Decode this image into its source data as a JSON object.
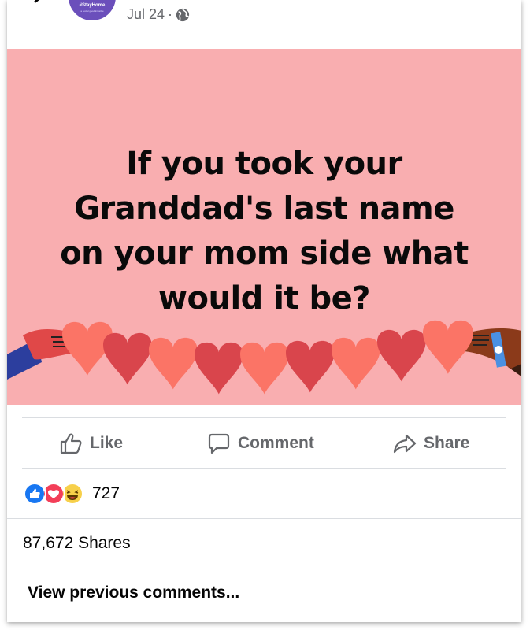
{
  "post": {
    "avatar_text": "#StayHome",
    "avatar_subtext": "a social good initiative",
    "date": "Jul 24",
    "separator": "·",
    "privacy_icon": "globe-icon"
  },
  "image": {
    "background": "#f9aeb0",
    "text_lines": [
      "If you took your",
      "Granddad's last name",
      "on your mom side what",
      "would it be?"
    ]
  },
  "actions": {
    "like_label": "Like",
    "comment_label": "Comment",
    "share_label": "Share"
  },
  "reactions": {
    "icons": [
      "like-icon",
      "love-icon",
      "haha-icon"
    ],
    "count": "727"
  },
  "shares_text": "87,672 Shares",
  "view_previous_label": "View previous comments..."
}
